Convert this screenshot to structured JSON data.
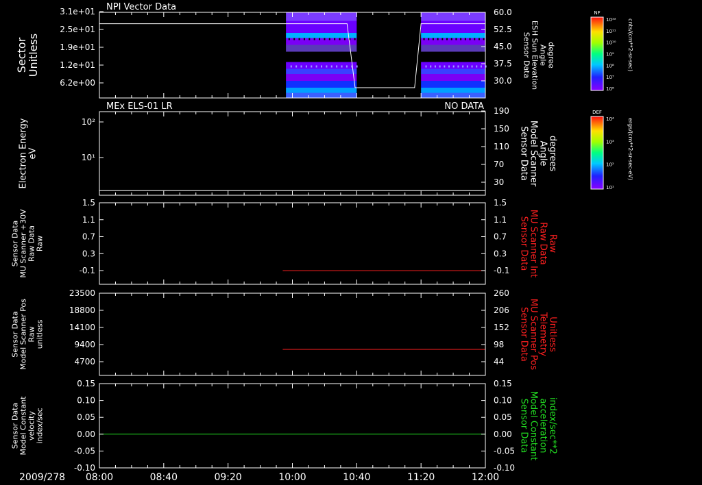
{
  "panels": [
    {
      "title": "NPI Vector Data",
      "title_right": "",
      "ylabel_left": [
        "Sector",
        "Unitless"
      ],
      "yticks_left": [
        "3.1e+01",
        "2.5e+01",
        "1.9e+01",
        "1.2e+01",
        "6.2e+00"
      ],
      "ylabel_right": [
        "Sensor Data",
        "ESH Sun Elevation",
        "Angle",
        "degree"
      ],
      "yticks_right": [
        "60.0",
        "52.5",
        "45.0",
        "37.5",
        "30.0"
      ]
    },
    {
      "title": "MEx ELS-01 LR",
      "title_right": "NO DATA",
      "ylabel_left": [
        "Electron Energy",
        "eV"
      ],
      "yticks_left": [
        "10²",
        "10¹"
      ],
      "ylabel_right": [
        "Sensor Data",
        "Model Scanner",
        "Angle",
        "degrees"
      ],
      "yticks_right": [
        "190",
        "150",
        "110",
        "70",
        "30"
      ]
    },
    {
      "title": "",
      "title_right": "",
      "ylabel_left": [
        "Sensor Data",
        "MU Scanner +30V",
        "Raw Data",
        "Raw"
      ],
      "yticks_left": [
        "1.5",
        "1.1",
        "0.7",
        "0.3",
        "-0.1"
      ],
      "ylabel_right": [
        "Sensor Data",
        "MU Scanner Int",
        "Raw Data",
        "Raw"
      ],
      "yticks_right": [
        "1.5",
        "1.1",
        "0.7",
        "0.3",
        "-0.1"
      ]
    },
    {
      "title": "",
      "title_right": "",
      "ylabel_left": [
        "Sensor Data",
        "Model Scanner Pos",
        "Raw",
        "unitless"
      ],
      "yticks_left": [
        "23500",
        "18800",
        "14100",
        "9400",
        "4700"
      ],
      "ylabel_right": [
        "Sensor Data",
        "MU Scanner Pos",
        "Telemetry",
        "Unitless"
      ],
      "yticks_right": [
        "260",
        "206",
        "152",
        "98",
        "44"
      ]
    },
    {
      "title": "",
      "title_right": "",
      "ylabel_left": [
        "Sensor Data",
        "Model Constant",
        "velocity",
        "index/sec"
      ],
      "yticks_left": [
        "0.15",
        "0.10",
        "0.05",
        "0.00",
        "-0.05",
        "-0.10"
      ],
      "ylabel_right": [
        "Sensor Data",
        "Model Constant",
        "acceleration",
        "index/sec**2"
      ],
      "yticks_right": [
        "0.15",
        "0.10",
        "0.05",
        "0.00",
        "-0.05",
        "-0.10"
      ]
    }
  ],
  "colorbars": [
    {
      "label": "NF",
      "unit": "cnts/(cm**2-sr-sec)",
      "ticks": [
        "10¹²",
        "10¹¹",
        "10¹⁰",
        "10⁹",
        "10⁸",
        "10⁷",
        "10⁶"
      ]
    },
    {
      "label": "DEF",
      "unit": "ergs/(cm**2-sr-sec-eV)",
      "ticks": [
        "10⁴",
        "10³",
        "10²",
        "10¹"
      ]
    }
  ],
  "x_axis": {
    "date": "2009/278",
    "ticks": [
      "08:00",
      "08:40",
      "09:20",
      "10:00",
      "10:40",
      "11:20",
      "12:00"
    ]
  },
  "colors": {
    "background": "#000000",
    "axes": "#ffffff",
    "panel3_right_label": "#ff2020",
    "panel4_right_label": "#ff2020",
    "panel5_right_label": "#22dd22",
    "panel3_line": "#ff2020",
    "panel4_line": "#ff2020",
    "panel5_line": "#22dd22"
  },
  "chart_data": [
    {
      "type": "heatmap",
      "title": "NPI Vector Data",
      "ylabel": "Sector Unitless",
      "x_range": [
        "08:00",
        "12:00"
      ],
      "data_blocks_x": [
        [
          "09:56",
          "10:40"
        ],
        [
          "11:20",
          "12:00"
        ]
      ],
      "overlay_line": {
        "name": "Sensor Data ESH Sun Elevation Angle",
        "x": [
          "08:00",
          "10:34",
          "10:39",
          "11:16",
          "11:20",
          "12:00"
        ],
        "y": [
          55.0,
          55.0,
          27.0,
          27.0,
          55.0,
          55.0
        ],
        "ylim": [
          22.5,
          60.0
        ]
      }
    },
    {
      "type": "line",
      "title": "MEx ELS-01 LR",
      "ylabel": "Electron Energy eV",
      "status": "NO DATA",
      "series": [
        {
          "name": "Sensor Data Model Scanner Angle",
          "x": [
            "08:00",
            "12:00"
          ],
          "y": [
            20,
            20
          ]
        }
      ],
      "ylim": [
        10,
        190
      ]
    },
    {
      "type": "line",
      "series": [
        {
          "name": "Sensor Data MU Scanner Int Raw Data",
          "x": [
            "09:54",
            "12:00"
          ],
          "y": [
            0.0,
            0.0
          ]
        }
      ],
      "ylim": [
        -0.3,
        1.5
      ]
    },
    {
      "type": "line",
      "series": [
        {
          "name": "Sensor Data MU Scanner Pos Telemetry",
          "x": [
            "09:54",
            "12:00"
          ],
          "y": [
            94,
            94
          ]
        }
      ],
      "ylim": [
        17,
        260
      ]
    },
    {
      "type": "line",
      "series": [
        {
          "name": "Sensor Data Model Constant acceleration",
          "x": [
            "08:00",
            "12:00"
          ],
          "y": [
            0.0,
            0.0
          ]
        }
      ],
      "ylim": [
        -0.1,
        0.15
      ]
    }
  ]
}
